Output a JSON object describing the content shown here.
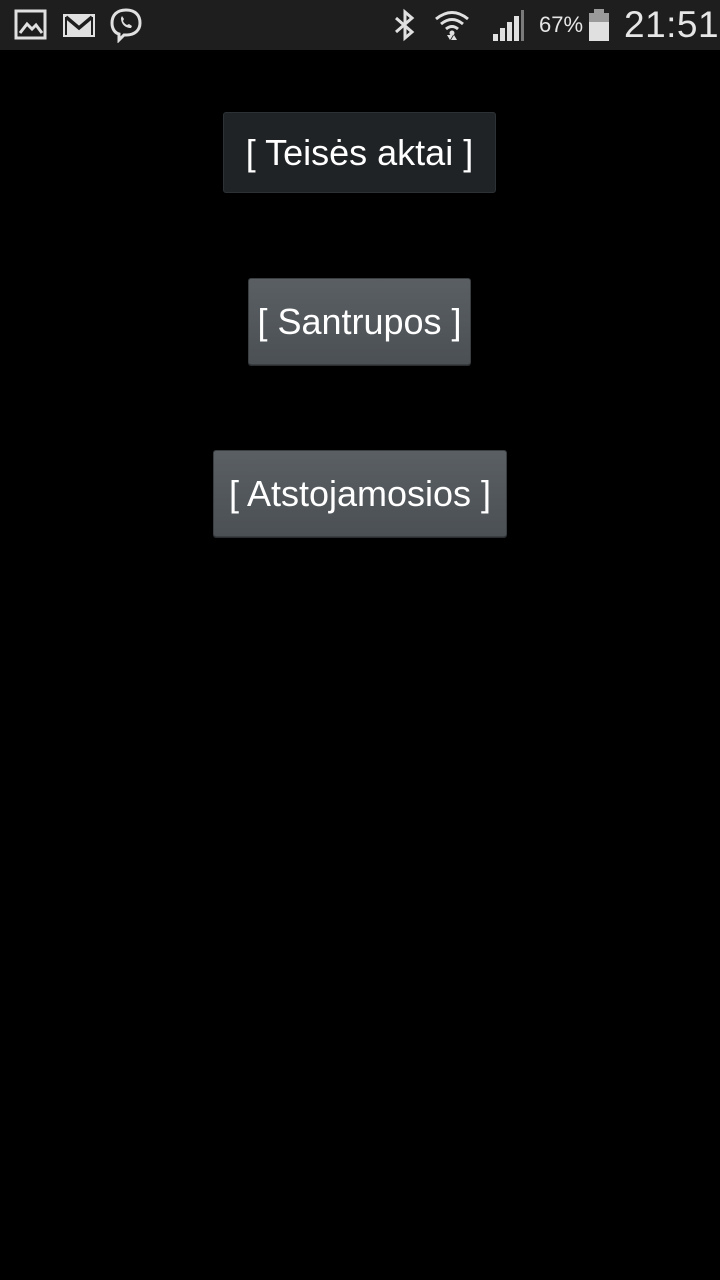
{
  "status_bar": {
    "battery_percent": "67%",
    "time": "21:51",
    "icons": [
      "gallery-icon",
      "gmail-icon",
      "viber-icon",
      "bluetooth-icon",
      "wifi-icon",
      "signal-icon",
      "battery-icon"
    ]
  },
  "menu": {
    "buttons": [
      {
        "label": "[ Teisės aktai ]"
      },
      {
        "label": "[ Santrupos ]"
      },
      {
        "label": "[ Atstojamosios ]"
      }
    ]
  },
  "colors": {
    "background": "#000000",
    "status_bar": "#1e1e1e",
    "button_dark": "#1f2326",
    "button_grey": "#53585c",
    "text": "#ffffff"
  }
}
